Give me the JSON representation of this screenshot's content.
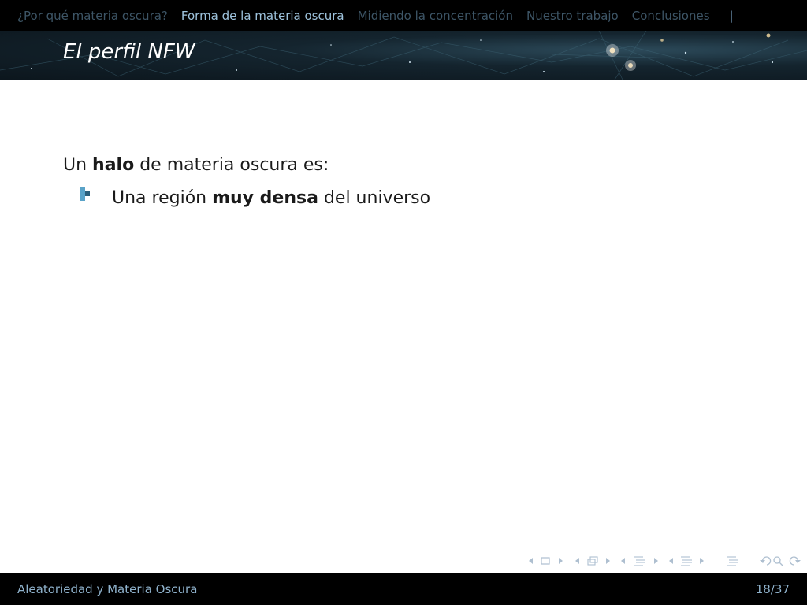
{
  "navigation": {
    "sections": [
      {
        "label": "¿Por qué materia oscura?",
        "active": false
      },
      {
        "label": "Forma de la materia oscura",
        "active": true
      },
      {
        "label": "Midiendo la concentración",
        "active": false
      },
      {
        "label": "Nuestro trabajo",
        "active": false
      },
      {
        "label": "Conclusiones",
        "active": false
      }
    ],
    "separator": "|"
  },
  "frame": {
    "title": "El perfil NFW"
  },
  "content": {
    "intro": {
      "before": "Un ",
      "bold": "halo",
      "after": " de materia oscura es:"
    },
    "bullets": [
      {
        "before": "Una región ",
        "bold": "muy densa",
        "after": " del universo"
      }
    ]
  },
  "footer": {
    "presentation_title": "Aleatoriedad y Materia Oscura",
    "page_indicator": "18/37"
  },
  "colors": {
    "nav_bar_background": "#000000",
    "nav_active": "#9ec3dd",
    "nav_inactive": "#3d5566",
    "bullet_dark": "#2b5f7a",
    "bullet_light": "#5aa3c8",
    "footer_text": "#8fb2cc",
    "text": "#1a1a1a"
  },
  "icons": {
    "bullet": "square-blocks-icon",
    "nav_symbols": [
      "arrow-left-icon",
      "frame-icon",
      "arrow-right-icon",
      "arrow-left-icon",
      "subsection-icon",
      "arrow-right-icon",
      "arrow-left-icon",
      "section-icon",
      "arrow-right-icon",
      "arrow-left-icon",
      "presentation-icon",
      "arrow-right-icon",
      "align-icon",
      "undo-icon",
      "search-icon",
      "redo-icon"
    ]
  }
}
